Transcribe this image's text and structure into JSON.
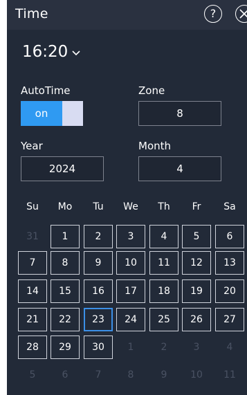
{
  "header": {
    "title": "Time",
    "help_glyph": "?"
  },
  "time": {
    "value": "16:20"
  },
  "auto_time": {
    "label": "AutoTime",
    "state_label": "on",
    "enabled": true
  },
  "zone": {
    "label": "Zone",
    "value": "8"
  },
  "year": {
    "label": "Year",
    "value": "2024"
  },
  "month": {
    "label": "Month",
    "value": "4"
  },
  "calendar": {
    "weekdays": [
      "Su",
      "Mo",
      "Tu",
      "We",
      "Th",
      "Fr",
      "Sa"
    ],
    "selected_day": "23",
    "weeks": [
      [
        {
          "d": "31",
          "cur": false
        },
        {
          "d": "1",
          "cur": true
        },
        {
          "d": "2",
          "cur": true
        },
        {
          "d": "3",
          "cur": true
        },
        {
          "d": "4",
          "cur": true
        },
        {
          "d": "5",
          "cur": true
        },
        {
          "d": "6",
          "cur": true
        }
      ],
      [
        {
          "d": "7",
          "cur": true
        },
        {
          "d": "8",
          "cur": true
        },
        {
          "d": "9",
          "cur": true
        },
        {
          "d": "10",
          "cur": true
        },
        {
          "d": "11",
          "cur": true
        },
        {
          "d": "12",
          "cur": true
        },
        {
          "d": "13",
          "cur": true
        }
      ],
      [
        {
          "d": "14",
          "cur": true
        },
        {
          "d": "15",
          "cur": true
        },
        {
          "d": "16",
          "cur": true
        },
        {
          "d": "17",
          "cur": true
        },
        {
          "d": "18",
          "cur": true
        },
        {
          "d": "19",
          "cur": true
        },
        {
          "d": "20",
          "cur": true
        }
      ],
      [
        {
          "d": "21",
          "cur": true
        },
        {
          "d": "22",
          "cur": true
        },
        {
          "d": "23",
          "cur": true
        },
        {
          "d": "24",
          "cur": true
        },
        {
          "d": "25",
          "cur": true
        },
        {
          "d": "26",
          "cur": true
        },
        {
          "d": "27",
          "cur": true
        }
      ],
      [
        {
          "d": "28",
          "cur": true
        },
        {
          "d": "29",
          "cur": true
        },
        {
          "d": "30",
          "cur": true
        },
        {
          "d": "1",
          "cur": false
        },
        {
          "d": "2",
          "cur": false
        },
        {
          "d": "3",
          "cur": false
        },
        {
          "d": "4",
          "cur": false
        }
      ],
      [
        {
          "d": "5",
          "cur": false
        },
        {
          "d": "6",
          "cur": false
        },
        {
          "d": "7",
          "cur": false
        },
        {
          "d": "8",
          "cur": false
        },
        {
          "d": "9",
          "cur": false
        },
        {
          "d": "10",
          "cur": false
        },
        {
          "d": "11",
          "cur": false
        }
      ]
    ]
  },
  "colors": {
    "panel_bg": "#222a38",
    "accent": "#2f9af2",
    "toggle_off": "#d8dcf2",
    "muted_day": "#4a5263",
    "selected_border": "#3b8fe6"
  }
}
